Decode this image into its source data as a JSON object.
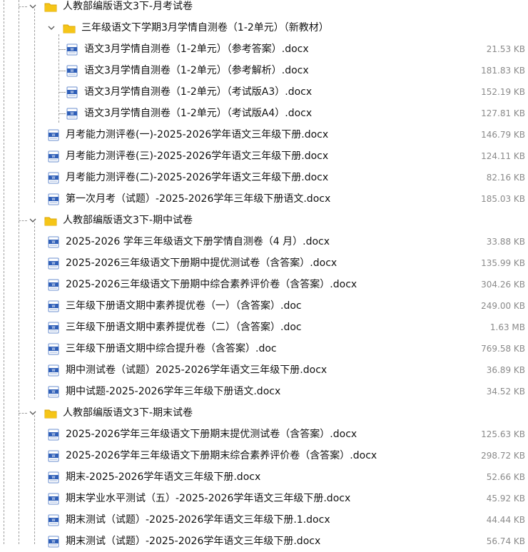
{
  "tree": [
    {
      "level": 0,
      "type": "folder",
      "expanded": true,
      "name": "人教部编版语文3下-月考试卷",
      "size": ""
    },
    {
      "level": 1,
      "type": "folder",
      "expanded": true,
      "name": "三年级语文下学期3月学情自测卷（1-2单元）（新教材）",
      "size": ""
    },
    {
      "level": 2,
      "type": "file",
      "name": "语文3月学情自测卷（1-2单元）（参考答案）.docx",
      "size": "21.53 KB"
    },
    {
      "level": 2,
      "type": "file",
      "name": "语文3月学情自测卷（1-2单元）（参考解析）.docx",
      "size": "181.83 KB"
    },
    {
      "level": 2,
      "type": "file",
      "name": "语文3月学情自测卷（1-2单元）（考试版A3）.docx",
      "size": "152.19 KB"
    },
    {
      "level": 2,
      "type": "file",
      "name": "语文3月学情自测卷（1-2单元）（考试版A4）.docx",
      "size": "127.81 KB"
    },
    {
      "level": 1,
      "type": "file",
      "name": "月考能力测评卷(一)-2025-2026学年语文三年级下册.docx",
      "size": "146.79 KB"
    },
    {
      "level": 1,
      "type": "file",
      "name": "月考能力测评卷(三)-2025-2026学年语文三年级下册.docx",
      "size": "124.11 KB"
    },
    {
      "level": 1,
      "type": "file",
      "name": "月考能力测评卷(二)-2025-2026学年语文三年级下册.docx",
      "size": "82.16 KB"
    },
    {
      "level": 1,
      "type": "file",
      "name": "第一次月考（试题）-2025-2026学年三年级下册语文.docx",
      "size": "185.03 KB"
    },
    {
      "level": 0,
      "type": "folder",
      "expanded": true,
      "name": "人教部编版语文3下-期中试卷",
      "size": ""
    },
    {
      "level": 1,
      "type": "file",
      "name": "2025-2026 学年三年级语文下册学情自测卷（4 月）.docx",
      "size": "33.88 KB"
    },
    {
      "level": 1,
      "type": "file",
      "name": "2025-2026三年级语文下册期中提优测试卷（含答案）.docx",
      "size": "135.99 KB"
    },
    {
      "level": 1,
      "type": "file",
      "name": "2025-2026三年级语文下册期中综合素养评价卷（含答案）.docx",
      "size": "304.26 KB"
    },
    {
      "level": 1,
      "type": "file",
      "name": "三年级下册语文期中素养提优卷（一）（含答案）.doc",
      "size": "249.00 KB"
    },
    {
      "level": 1,
      "type": "file",
      "name": "三年级下册语文期中素养提优卷（二）（含答案）.doc",
      "size": "1.63 MB"
    },
    {
      "level": 1,
      "type": "file",
      "name": "三年级下册语文期中综合提升卷（含答案）.doc",
      "size": "769.58 KB"
    },
    {
      "level": 1,
      "type": "file",
      "name": "期中测试卷（试题）2025-2026学年语文三年级下册.docx",
      "size": "36.89 KB"
    },
    {
      "level": 1,
      "type": "file",
      "name": "期中试题-2025-2026学年三年级下册语文.docx",
      "size": "34.52 KB"
    },
    {
      "level": 0,
      "type": "folder",
      "expanded": true,
      "name": "人教部编版语文3下-期末试卷",
      "size": ""
    },
    {
      "level": 1,
      "type": "file",
      "name": "2025-2026学年三年级语文下册期末提优测试卷（含答案）.docx",
      "size": "125.63 KB"
    },
    {
      "level": 1,
      "type": "file",
      "name": "2025-2026学年三年级语文下册期末综合素养评价卷（含答案）.docx",
      "size": "298.72 KB"
    },
    {
      "level": 1,
      "type": "file",
      "name": "期末-2025-2026学年语文三年级下册.docx",
      "size": "52.66 KB"
    },
    {
      "level": 1,
      "type": "file",
      "name": "期末学业水平测试（五）-2025-2026学年语文三年级下册.docx",
      "size": "45.92 KB"
    },
    {
      "level": 1,
      "type": "file",
      "name": "期末测试（试题）-2025-2026学年语文三年级下册.1.docx",
      "size": "44.44 KB"
    },
    {
      "level": 1,
      "type": "file",
      "name": "期末测试（试题）-2025-2026学年语文三年级下册.docx",
      "size": "56.74 KB"
    }
  ],
  "icons": {
    "folder": "folder-icon",
    "file": "word-document-icon",
    "toggle": "chevron-down-icon"
  },
  "colors": {
    "folder": "#f5c518",
    "folder_dark": "#d9a400",
    "doc_blue": "#2f5fb8",
    "size_text": "#8a8a8a",
    "guide_line": "#a0a0a0"
  }
}
